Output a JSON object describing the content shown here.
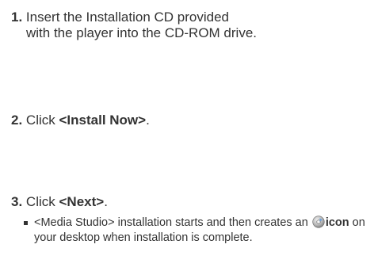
{
  "steps": [
    {
      "number": "1.",
      "line1": "Insert the Installation CD provided",
      "line2": "with the player into the CD-ROM drive."
    },
    {
      "number": "2.",
      "prefix": "Click ",
      "bold": "<Install Now>",
      "suffix": "."
    },
    {
      "number": "3.",
      "prefix": "Click ",
      "bold": "<Next>",
      "suffix": "."
    }
  ],
  "bullet": {
    "text_before_icon": "<Media Studio> installation starts and then creates an ",
    "icon": "media-studio-cd-icon",
    "bold_after_icon": "icon",
    "text_after": " on your desktop when installation is complete."
  }
}
